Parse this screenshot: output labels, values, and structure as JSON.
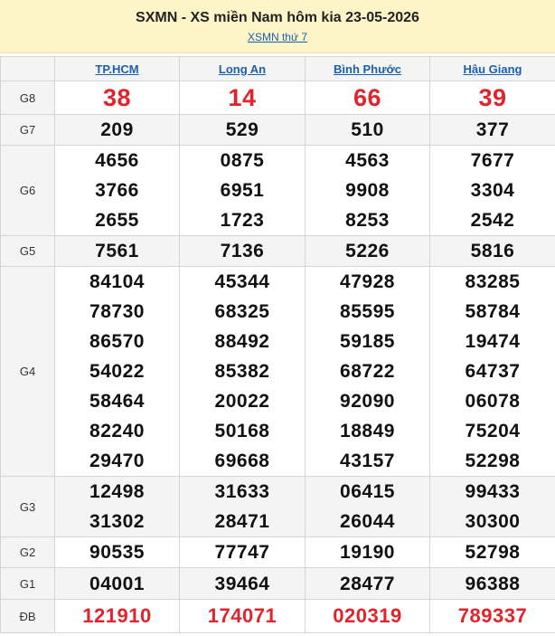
{
  "header": {
    "title": "SXMN - XS miền Nam hôm kia 23-05-2026",
    "sublink": "XSMN thứ 7"
  },
  "provinces": [
    "TP.HCM",
    "Long An",
    "Bình Phước",
    "Hậu Giang"
  ],
  "rows": [
    {
      "label": "G8",
      "values": [
        [
          "38"
        ],
        [
          "14"
        ],
        [
          "66"
        ],
        [
          "39"
        ]
      ]
    },
    {
      "label": "G7",
      "values": [
        [
          "209"
        ],
        [
          "529"
        ],
        [
          "510"
        ],
        [
          "377"
        ]
      ]
    },
    {
      "label": "G6",
      "values": [
        [
          "4656",
          "3766",
          "2655"
        ],
        [
          "0875",
          "6951",
          "1723"
        ],
        [
          "4563",
          "9908",
          "8253"
        ],
        [
          "7677",
          "3304",
          "2542"
        ]
      ]
    },
    {
      "label": "G5",
      "values": [
        [
          "7561"
        ],
        [
          "7136"
        ],
        [
          "5226"
        ],
        [
          "5816"
        ]
      ]
    },
    {
      "label": "G4",
      "values": [
        [
          "84104",
          "78730",
          "86570",
          "54022",
          "58464",
          "82240",
          "29470"
        ],
        [
          "45344",
          "68325",
          "88492",
          "85382",
          "20022",
          "50168",
          "69668"
        ],
        [
          "47928",
          "85595",
          "59185",
          "68722",
          "92090",
          "18849",
          "43157"
        ],
        [
          "83285",
          "58784",
          "19474",
          "64737",
          "06078",
          "75204",
          "52298"
        ]
      ]
    },
    {
      "label": "G3",
      "values": [
        [
          "12498",
          "31302"
        ],
        [
          "31633",
          "28471"
        ],
        [
          "06415",
          "26044"
        ],
        [
          "99433",
          "30300"
        ]
      ]
    },
    {
      "label": "G2",
      "values": [
        [
          "90535"
        ],
        [
          "77747"
        ],
        [
          "19190"
        ],
        [
          "52798"
        ]
      ]
    },
    {
      "label": "G1",
      "values": [
        [
          "04001"
        ],
        [
          "39464"
        ],
        [
          "28477"
        ],
        [
          "96388"
        ]
      ]
    },
    {
      "label": "ĐB",
      "values": [
        [
          "121910"
        ],
        [
          "174071"
        ],
        [
          "020319"
        ],
        [
          "789337"
        ]
      ]
    }
  ],
  "colors": {
    "red": "#e1242b",
    "link": "#1a5fb4",
    "header_bg": "#fdf5c8"
  }
}
